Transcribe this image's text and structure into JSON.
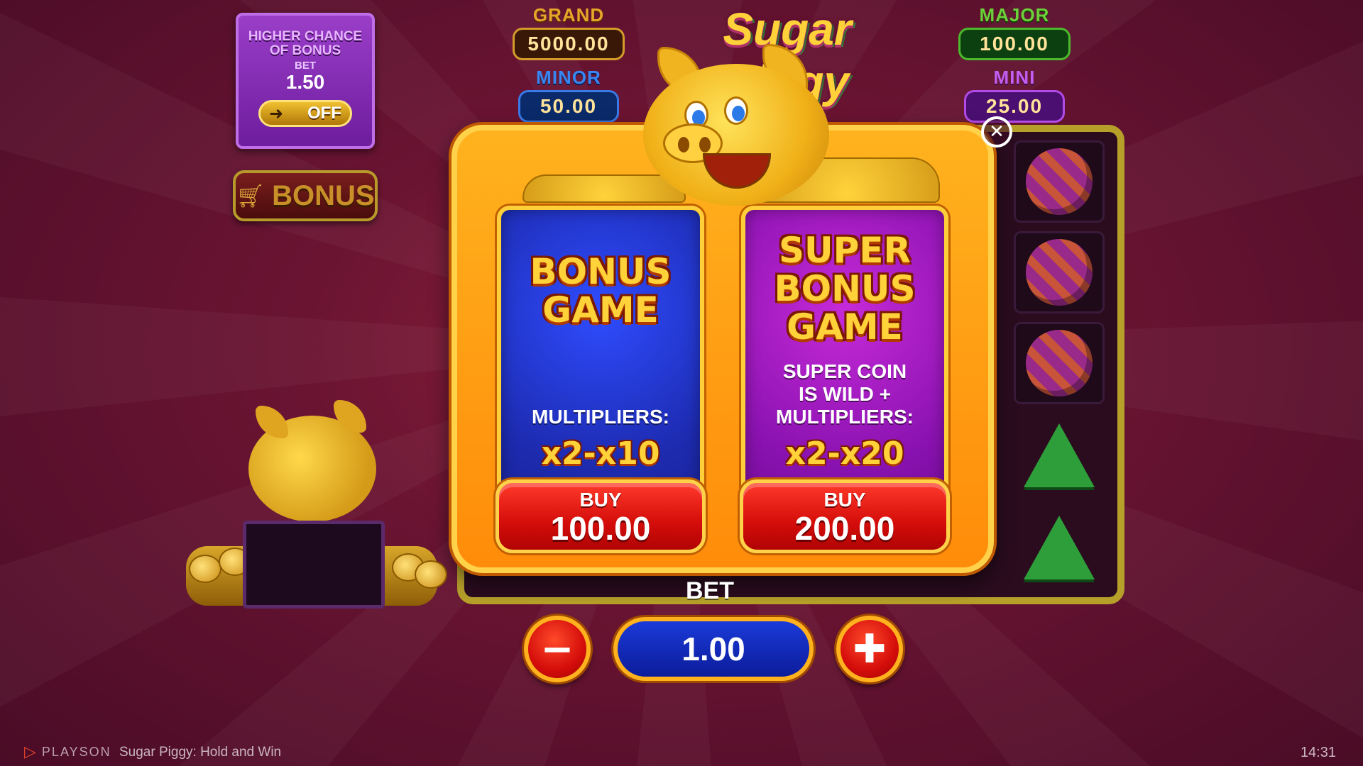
{
  "game": {
    "logo": "Sugar Piggy"
  },
  "chance_panel": {
    "title": "HIGHER CHANCE OF BONUS",
    "bet_label": "BET",
    "bet_value": "1.50",
    "toggle_state": "OFF",
    "toggle_icon": "arrow-right-icon"
  },
  "bonus_shop": {
    "label": "BONUS",
    "icon": "cart-icon"
  },
  "jackpots": {
    "grand": {
      "label": "GRAND",
      "value": "5000.00"
    },
    "major": {
      "label": "MAJOR",
      "value": "100.00"
    },
    "minor": {
      "label": "MINOR",
      "value": "50.00"
    },
    "mini": {
      "label": "MINI",
      "value": "25.00"
    }
  },
  "popup": {
    "close_icon": "close-icon",
    "bonus_game": {
      "title_line1": "BONUS",
      "title_line2": "GAME",
      "description": "MULTIPLIERS:",
      "multipliers": "x2-x10",
      "buy_label": "BUY",
      "price": "100.00",
      "color": "#1d2bb0"
    },
    "super_bonus_game": {
      "title_line1": "SUPER",
      "title_line2": "BONUS",
      "title_line3": "GAME",
      "description_line1": "SUPER COIN",
      "description_line2": "IS WILD +",
      "description_line3": "MULTIPLIERS:",
      "multipliers": "x2-x20",
      "buy_label": "BUY",
      "price": "200.00",
      "color": "#8a12b0"
    }
  },
  "bet": {
    "label": "BET",
    "value": "1.00",
    "minus_label": "−",
    "plus_label": "✚"
  },
  "footer": {
    "brand": "PLAYSON",
    "game_title": "Sugar Piggy: Hold and Win",
    "time": "14:31"
  },
  "colors": {
    "background": "#6a1432",
    "popup_orange": "#ff8c0a",
    "buy_red": "#d40d0a",
    "bet_blue": "#0c1c9a"
  }
}
